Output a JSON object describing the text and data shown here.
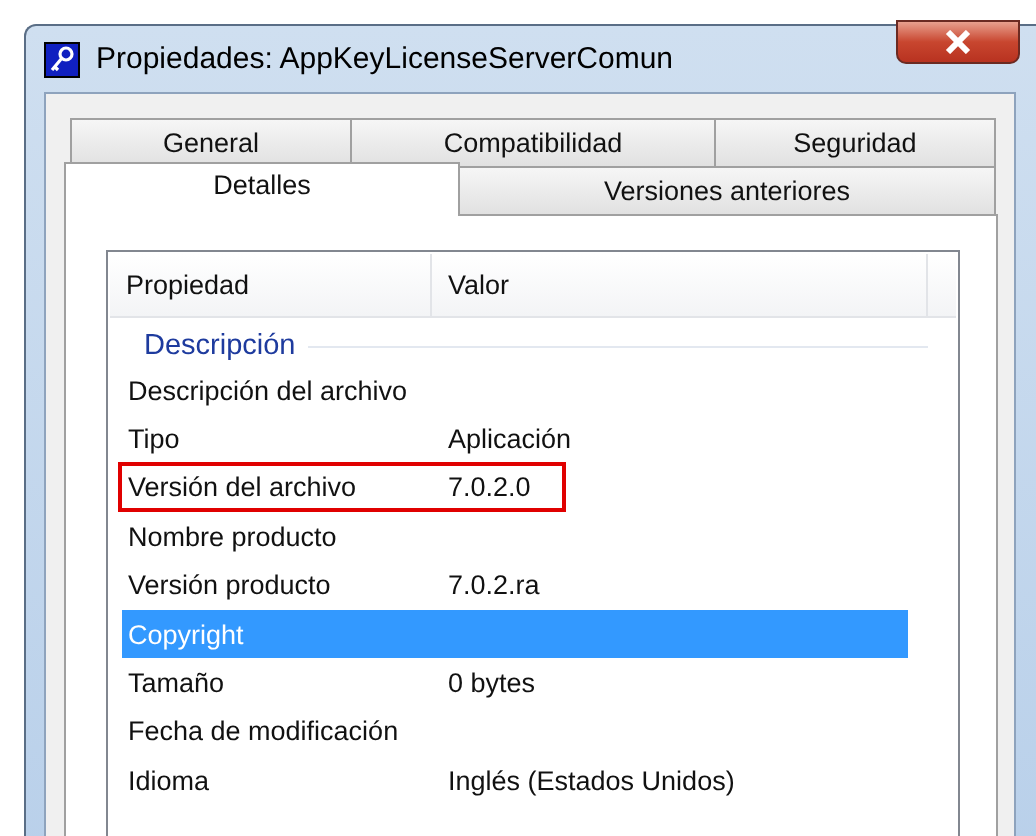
{
  "window": {
    "title": "Propiedades: AppKeyLicenseServerComun"
  },
  "tab_rows": [
    [
      {
        "label": "General",
        "selected": false
      },
      {
        "label": "Compatibilidad",
        "selected": false
      },
      {
        "label": "Seguridad",
        "selected": false
      }
    ],
    [
      {
        "label": "Detalles",
        "selected": true
      },
      {
        "label": "Versiones anteriores",
        "selected": false
      }
    ]
  ],
  "table": {
    "columns": [
      "Propiedad",
      "Valor"
    ],
    "group": "Descripción",
    "rows": [
      {
        "property": "Descripción del archivo",
        "value": "",
        "selected": false,
        "outlined": false
      },
      {
        "property": "Tipo",
        "value": "Aplicación",
        "selected": false,
        "outlined": false
      },
      {
        "property": "Versión del archivo",
        "value": "7.0.2.0",
        "selected": false,
        "outlined": true
      },
      {
        "property": "Nombre producto",
        "value": "",
        "selected": false,
        "outlined": false
      },
      {
        "property": "Versión producto",
        "value": "7.0.2.ra",
        "selected": false,
        "outlined": false
      },
      {
        "property": "Copyright",
        "value": "",
        "selected": true,
        "outlined": false
      },
      {
        "property": "Tamaño",
        "value": "0 bytes",
        "selected": false,
        "outlined": false
      },
      {
        "property": "Fecha de modificación",
        "value": "",
        "selected": false,
        "outlined": false
      },
      {
        "property": "Idioma",
        "value": "Inglés (Estados Unidos)",
        "selected": false,
        "outlined": false
      }
    ]
  }
}
